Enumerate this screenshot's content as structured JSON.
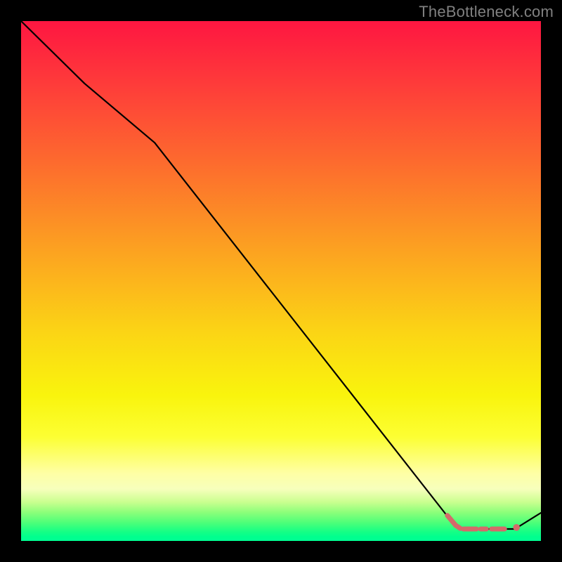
{
  "attribution": "TheBottleneck.com",
  "chart_data": {
    "type": "line",
    "title": "",
    "xlabel": "",
    "ylabel": "",
    "xlim": [
      0,
      100
    ],
    "ylim": [
      0,
      100
    ],
    "grid": false,
    "legend": false,
    "background_gradient": {
      "orientation": "vertical",
      "stops": [
        {
          "pos": 0.0,
          "color": "#fe1641"
        },
        {
          "pos": 0.27,
          "color": "#fd6a2e"
        },
        {
          "pos": 0.6,
          "color": "#fbd515"
        },
        {
          "pos": 0.8,
          "color": "#fcff33"
        },
        {
          "pos": 0.9,
          "color": "#f7ffbc"
        },
        {
          "pos": 0.96,
          "color": "#4dff79"
        },
        {
          "pos": 1.0,
          "color": "#00ff93"
        }
      ]
    },
    "series": [
      {
        "name": "curve",
        "color": "#000000",
        "x": [
          0.0,
          12.2,
          25.7,
          82.2,
          84.1,
          95.0,
          100.0
        ],
        "y": [
          100.0,
          88.0,
          76.6,
          4.5,
          2.3,
          2.3,
          5.4
        ]
      }
    ],
    "annotations": [
      {
        "name": "marker-cluster",
        "shape": "dashes",
        "color": "#d46a6a",
        "approx_center": {
          "x": 89.0,
          "y": 2.3
        },
        "segments": [
          {
            "x0": 82.0,
            "y0": 4.9,
            "x1": 83.6,
            "y1": 3.0
          },
          {
            "x0": 83.6,
            "y0": 3.0,
            "x1": 84.5,
            "y1": 2.4
          },
          {
            "x0": 85.1,
            "y0": 2.3,
            "x1": 87.6,
            "y1": 2.3
          },
          {
            "x0": 88.4,
            "y0": 2.3,
            "x1": 89.5,
            "y1": 2.3
          },
          {
            "x0": 90.5,
            "y0": 2.3,
            "x1": 93.0,
            "y1": 2.3
          }
        ],
        "dot": {
          "x": 95.3,
          "y": 2.6,
          "r_pct": 0.65
        }
      }
    ]
  }
}
